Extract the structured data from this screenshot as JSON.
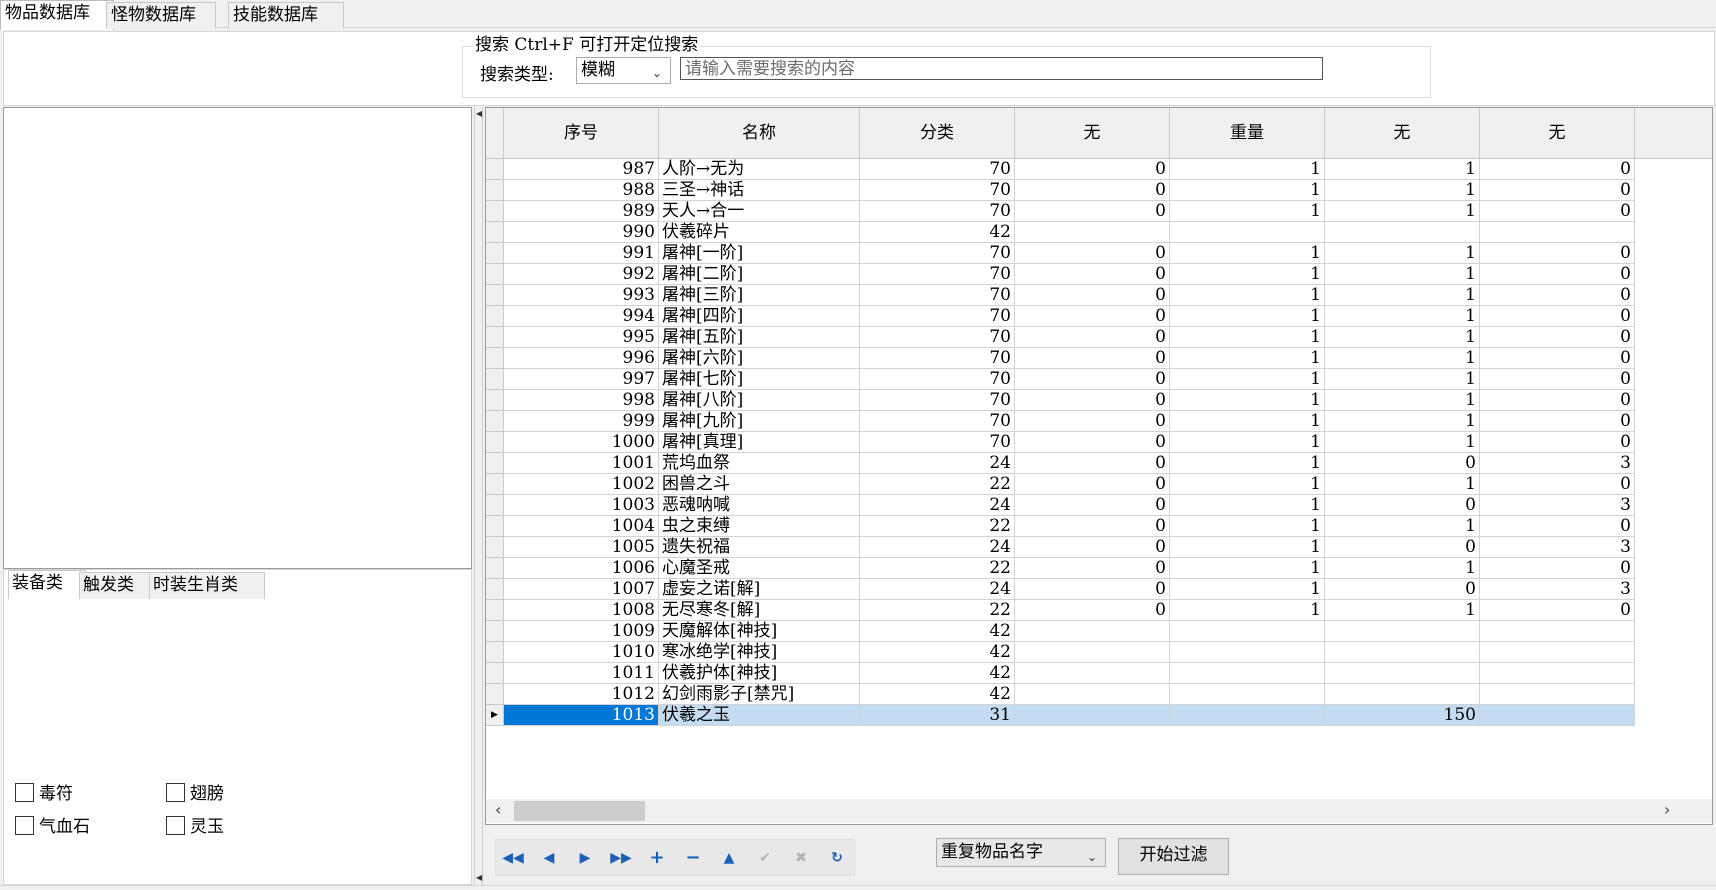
{
  "top_tabs": [
    {
      "label": "物品数据库",
      "active": true
    },
    {
      "label": "怪物数据库",
      "active": false
    },
    {
      "label": "技能数据库",
      "active": false
    }
  ],
  "search": {
    "title": "搜索  Ctrl+F 可打开定位搜索",
    "type_label": "搜索类型:",
    "type_value": "模糊",
    "placeholder": "请输入需要搜索的内容",
    "value": ""
  },
  "left_tabs": [
    {
      "label": "装备类",
      "active": true
    },
    {
      "label": "触发类",
      "active": false
    },
    {
      "label": "时装生肖类",
      "active": false
    }
  ],
  "checkboxes": [
    {
      "label": "毒符",
      "checked": false
    },
    {
      "label": "翅膀",
      "checked": false
    },
    {
      "label": "气血石",
      "checked": false
    },
    {
      "label": "灵玉",
      "checked": false
    }
  ],
  "grid": {
    "columns": [
      "序号",
      "名称",
      "分类",
      "无",
      "重量",
      "无",
      "无"
    ],
    "selected_row_index": 26,
    "rows": [
      [
        "987",
        "人阶→无为",
        "70",
        "0",
        "1",
        "1",
        "0"
      ],
      [
        "988",
        "三圣→神话",
        "70",
        "0",
        "1",
        "1",
        "0"
      ],
      [
        "989",
        "天人→合一",
        "70",
        "0",
        "1",
        "1",
        "0"
      ],
      [
        "990",
        "伏羲碎片",
        "42",
        "",
        "",
        "",
        ""
      ],
      [
        "991",
        "屠神[一阶]",
        "70",
        "0",
        "1",
        "1",
        "0"
      ],
      [
        "992",
        "屠神[二阶]",
        "70",
        "0",
        "1",
        "1",
        "0"
      ],
      [
        "993",
        "屠神[三阶]",
        "70",
        "0",
        "1",
        "1",
        "0"
      ],
      [
        "994",
        "屠神[四阶]",
        "70",
        "0",
        "1",
        "1",
        "0"
      ],
      [
        "995",
        "屠神[五阶]",
        "70",
        "0",
        "1",
        "1",
        "0"
      ],
      [
        "996",
        "屠神[六阶]",
        "70",
        "0",
        "1",
        "1",
        "0"
      ],
      [
        "997",
        "屠神[七阶]",
        "70",
        "0",
        "1",
        "1",
        "0"
      ],
      [
        "998",
        "屠神[八阶]",
        "70",
        "0",
        "1",
        "1",
        "0"
      ],
      [
        "999",
        "屠神[九阶]",
        "70",
        "0",
        "1",
        "1",
        "0"
      ],
      [
        "1000",
        "屠神[真理]",
        "70",
        "0",
        "1",
        "1",
        "0"
      ],
      [
        "1001",
        "荒坞血祭",
        "24",
        "0",
        "1",
        "0",
        "3"
      ],
      [
        "1002",
        "困兽之斗",
        "22",
        "0",
        "1",
        "1",
        "0"
      ],
      [
        "1003",
        "恶魂呐喊",
        "24",
        "0",
        "1",
        "0",
        "3"
      ],
      [
        "1004",
        "虫之束缚",
        "22",
        "0",
        "1",
        "1",
        "0"
      ],
      [
        "1005",
        "遗失祝福",
        "24",
        "0",
        "1",
        "0",
        "3"
      ],
      [
        "1006",
        "心魔圣戒",
        "22",
        "0",
        "1",
        "1",
        "0"
      ],
      [
        "1007",
        "虚妄之诺[解]",
        "24",
        "0",
        "1",
        "0",
        "3"
      ],
      [
        "1008",
        "无尽寒冬[解]",
        "22",
        "0",
        "1",
        "1",
        "0"
      ],
      [
        "1009",
        "天魔解体[神技]",
        "42",
        "",
        "",
        "",
        ""
      ],
      [
        "1010",
        "寒冰绝学[神技]",
        "42",
        "",
        "",
        "",
        ""
      ],
      [
        "1011",
        "伏羲护体[神技]",
        "42",
        "",
        "",
        "",
        ""
      ],
      [
        "1012",
        "幻剑雨影子[禁咒]",
        "42",
        "",
        "",
        "",
        ""
      ],
      [
        "1013",
        "伏羲之玉",
        "31",
        "",
        "",
        "150",
        ""
      ]
    ]
  },
  "filter": {
    "select_value": "重复物品名字",
    "button_label": "开始过滤"
  },
  "navigator": {
    "icons": [
      "first-record-icon",
      "prior-record-icon",
      "next-record-icon",
      "last-record-icon",
      "insert-record-icon",
      "delete-record-icon",
      "edit-record-icon",
      "post-edit-icon",
      "cancel-edit-icon",
      "refresh-icon"
    ]
  }
}
